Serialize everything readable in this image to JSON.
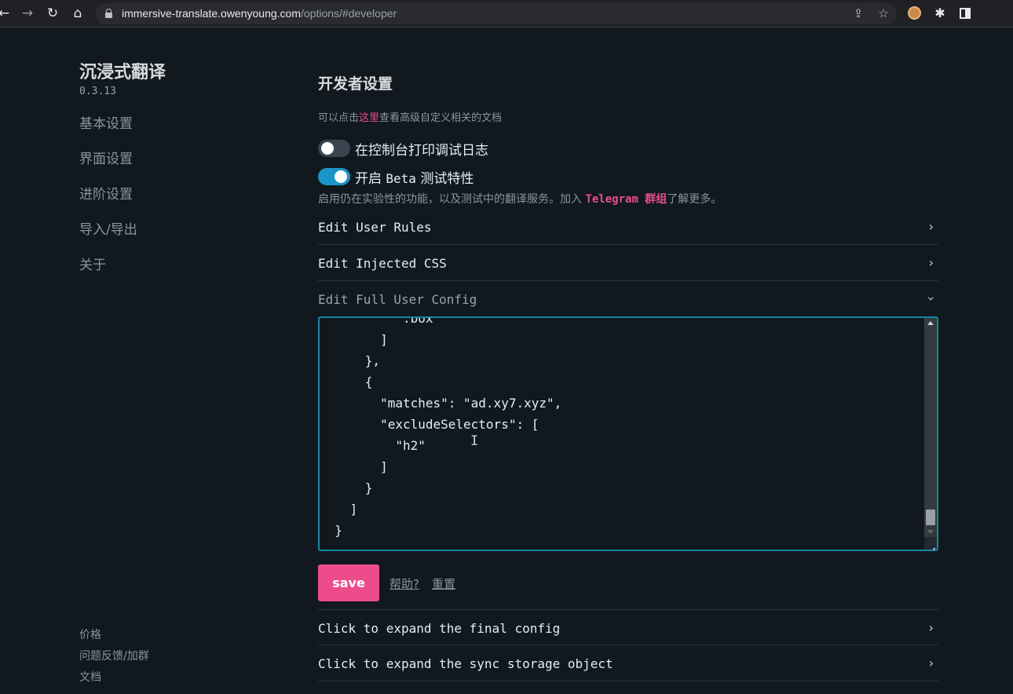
{
  "browser": {
    "url_host": "immersive-translate.owenyoung.com",
    "url_path": "/options/#developer"
  },
  "sidebar": {
    "brand": "沉浸式翻译",
    "version": "0.3.13",
    "nav": [
      {
        "label": "基本设置"
      },
      {
        "label": "界面设置"
      },
      {
        "label": "进阶设置"
      },
      {
        "label": "导入/导出"
      },
      {
        "label": "关于"
      }
    ],
    "footer": [
      {
        "label": "价格"
      },
      {
        "label": "问题反馈/加群"
      },
      {
        "label": "文档"
      }
    ]
  },
  "main": {
    "title": "开发者设置",
    "doc_hint_prefix": "可以点击",
    "doc_hint_link": "这里",
    "doc_hint_suffix": "查看高级自定义相关的文档",
    "debug_toggle": {
      "label": "在控制台打印调试日志",
      "on": false
    },
    "beta_toggle": {
      "label_a": "开启 ",
      "label_mono": "Beta",
      "label_b": " 测试特性",
      "on": true
    },
    "beta_desc_prefix": "启用仍在实验性的功能，以及测试中的翻译服务。加入 ",
    "beta_desc_link": "Telegram 群组",
    "beta_desc_suffix": "了解更多。",
    "sections": {
      "user_rules": "Edit User Rules",
      "injected_css": "Edit Injected CSS",
      "full_config": "Edit Full User Config",
      "final_config": "Click to expand the final config",
      "sync_storage": "Click to expand the sync storage object"
    },
    "editor_lines": [
      "        \".box\"",
      "      ]",
      "    },",
      "    {",
      "      \"matches\": \"ad.xy7.xyz\",",
      "      \"excludeSelectors\": [",
      "        \"h2\"",
      "      ]",
      "    }",
      "  ]",
      "}"
    ],
    "save_label": "save",
    "help_label": "帮助?",
    "reset_label": "重置"
  }
}
